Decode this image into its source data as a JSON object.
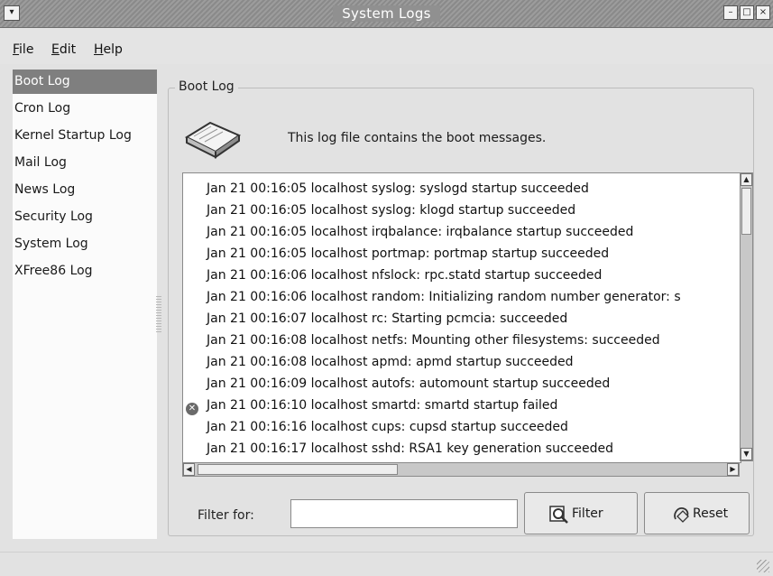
{
  "window": {
    "title": "System Logs",
    "menu_button": "▾",
    "minimize": "–",
    "maximize": "□",
    "close": "×"
  },
  "menubar": {
    "file": {
      "accel": "F",
      "rest": "ile"
    },
    "edit": {
      "accel": "E",
      "rest": "dit"
    },
    "help": {
      "accel": "H",
      "rest": "elp"
    }
  },
  "sidebar": {
    "selected_index": 0,
    "items": [
      {
        "label": "Boot Log"
      },
      {
        "label": "Cron Log"
      },
      {
        "label": "Kernel Startup Log"
      },
      {
        "label": "Mail Log"
      },
      {
        "label": "News Log"
      },
      {
        "label": "Security Log"
      },
      {
        "label": "System Log"
      },
      {
        "label": "XFree86 Log"
      }
    ]
  },
  "main": {
    "frame_title": "Boot Log",
    "description": "This log file contains the boot messages.",
    "log_lines": [
      {
        "text": "Jan 21 00:16:05 localhost syslog: syslogd startup succeeded",
        "error": false
      },
      {
        "text": "Jan 21 00:16:05 localhost syslog: klogd startup succeeded",
        "error": false
      },
      {
        "text": "Jan 21 00:16:05 localhost irqbalance: irqbalance startup succeeded",
        "error": false
      },
      {
        "text": "Jan 21 00:16:05 localhost portmap: portmap startup succeeded",
        "error": false
      },
      {
        "text": "Jan 21 00:16:06 localhost nfslock: rpc.statd startup succeeded",
        "error": false
      },
      {
        "text": "Jan 21 00:16:06 localhost random: Initializing random number generator:  s",
        "error": false
      },
      {
        "text": "Jan 21 00:16:07 localhost rc: Starting pcmcia:  succeeded",
        "error": false
      },
      {
        "text": "Jan 21 00:16:08 localhost netfs: Mounting other filesystems:  succeeded",
        "error": false
      },
      {
        "text": "Jan 21 00:16:08 localhost apmd: apmd startup succeeded",
        "error": false
      },
      {
        "text": "Jan 21 00:16:09 localhost autofs: automount startup succeeded",
        "error": false
      },
      {
        "text": "Jan 21 00:16:10 localhost smartd: smartd startup failed",
        "error": true
      },
      {
        "text": "Jan 21 00:16:16 localhost cups: cupsd startup succeeded",
        "error": false
      },
      {
        "text": "Jan 21 00:16:17 localhost sshd: RSA1 key generation succeeded",
        "error": false
      }
    ],
    "error_icon_glyph": "✕",
    "scroll_up": "▲",
    "scroll_down": "▼",
    "scroll_left": "◀",
    "scroll_right": "▶"
  },
  "filter": {
    "label": "Filter for:",
    "value": "",
    "placeholder": "",
    "filter_button": "Filter",
    "reset_button": "Reset"
  },
  "icons": {
    "book": "book-icon",
    "filter": "magnifier-icon",
    "reset": "reset-icon",
    "error": "error-icon"
  }
}
